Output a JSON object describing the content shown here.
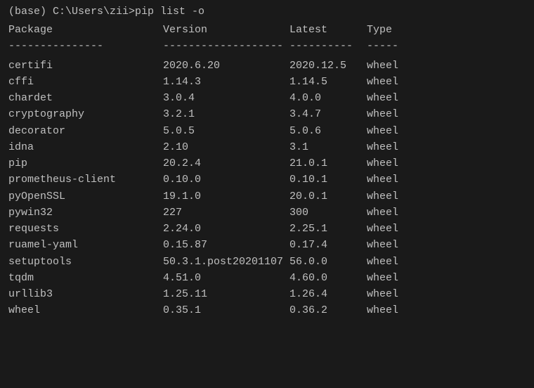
{
  "terminal": {
    "command": "(base) C:\\Users\\zii>pip list -o",
    "header": {
      "package": "Package",
      "version": "Version",
      "latest": "Latest",
      "type": "Type"
    },
    "divider": {
      "package": "---------------",
      "version": "-------------------",
      "latest": "----------",
      "type": "-----"
    },
    "rows": [
      {
        "package": "certifi",
        "version": "2020.6.20",
        "latest": "2020.12.5",
        "type": "wheel"
      },
      {
        "package": "cffi",
        "version": "1.14.3",
        "latest": "1.14.5",
        "type": "wheel"
      },
      {
        "package": "chardet",
        "version": "3.0.4",
        "latest": "4.0.0",
        "type": "wheel"
      },
      {
        "package": "cryptography",
        "version": "3.2.1",
        "latest": "3.4.7",
        "type": "wheel"
      },
      {
        "package": "decorator",
        "version": "5.0.5",
        "latest": "5.0.6",
        "type": "wheel"
      },
      {
        "package": "idna",
        "version": "2.10",
        "latest": "3.1",
        "type": "wheel"
      },
      {
        "package": "pip",
        "version": "20.2.4",
        "latest": "21.0.1",
        "type": "wheel"
      },
      {
        "package": "prometheus-client",
        "version": "0.10.0",
        "latest": "0.10.1",
        "type": "wheel"
      },
      {
        "package": "pyOpenSSL",
        "version": "19.1.0",
        "latest": "20.0.1",
        "type": "wheel"
      },
      {
        "package": "pywin32",
        "version": "227",
        "latest": "300",
        "type": "wheel"
      },
      {
        "package": "requests",
        "version": "2.24.0",
        "latest": "2.25.1",
        "type": "wheel"
      },
      {
        "package": "ruamel-yaml",
        "version": "0.15.87",
        "latest": "0.17.4",
        "type": "wheel"
      },
      {
        "package": "setuptools",
        "version": "50.3.1.post20201107",
        "latest": "56.0.0",
        "type": "wheel"
      },
      {
        "package": "tqdm",
        "version": "4.51.0",
        "latest": "4.60.0",
        "type": "wheel"
      },
      {
        "package": "urllib3",
        "version": "1.25.11",
        "latest": "1.26.4",
        "type": "wheel"
      },
      {
        "package": "wheel",
        "version": "0.35.1",
        "latest": "0.36.2",
        "type": "wheel"
      }
    ]
  }
}
